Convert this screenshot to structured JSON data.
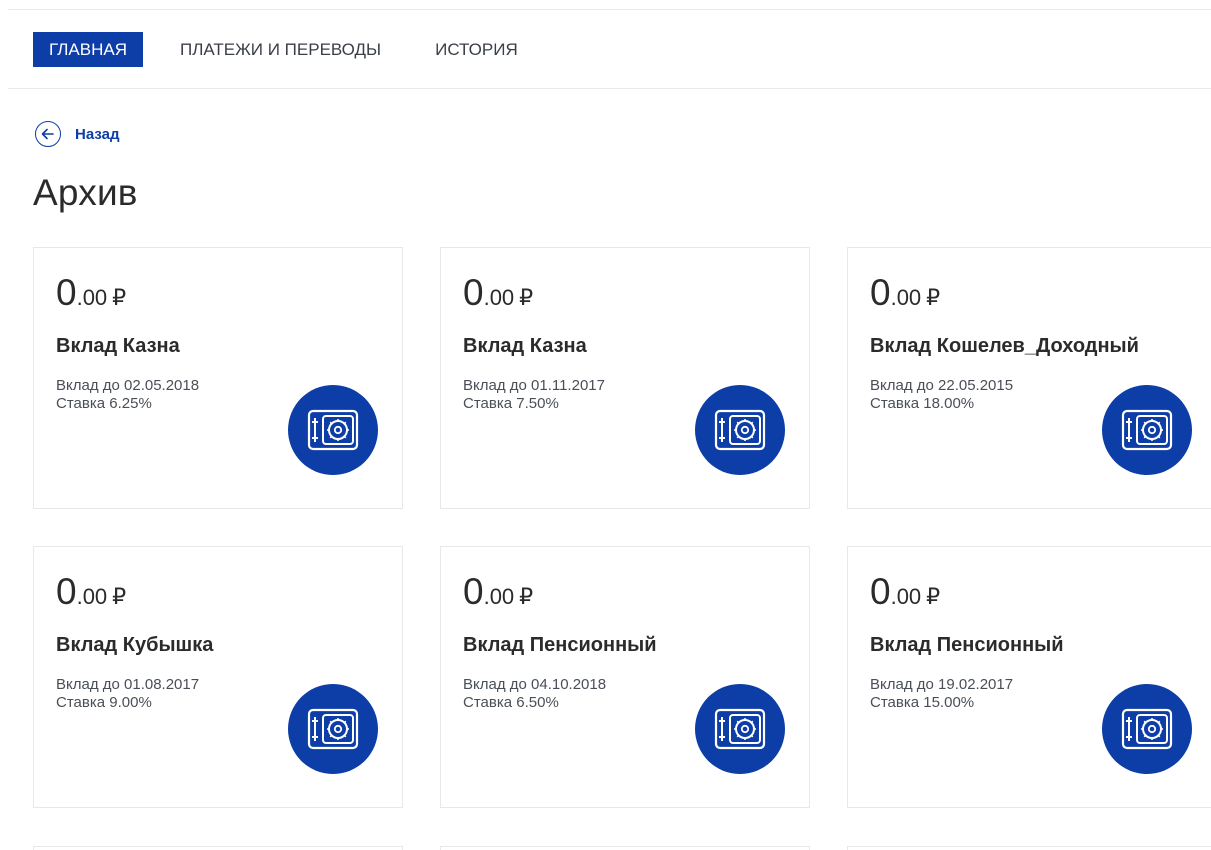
{
  "nav": {
    "tabs": [
      {
        "label": "ГЛАВНАЯ",
        "active": true
      },
      {
        "label": "ПЛАТЕЖИ И ПЕРЕВОДЫ",
        "active": false
      },
      {
        "label": "ИСТОРИЯ",
        "active": false
      }
    ]
  },
  "back": {
    "label": "Назад",
    "icon": "arrow-left-circle-icon"
  },
  "page": {
    "title": "Архив"
  },
  "colors": {
    "accent": "#0d3da6",
    "border": "#e6e8eb",
    "text": "#2b2b2b"
  },
  "deposits": [
    {
      "amount_int": "0",
      "amount_frac": ".00",
      "currency": "₽",
      "name": "Вклад Казна",
      "term": "Вклад до 02.05.2018",
      "rate": "Ставка 6.25%",
      "icon": "safe-icon"
    },
    {
      "amount_int": "0",
      "amount_frac": ".00",
      "currency": "₽",
      "name": "Вклад Казна",
      "term": "Вклад до 01.11.2017",
      "rate": "Ставка 7.50%",
      "icon": "safe-icon"
    },
    {
      "amount_int": "0",
      "amount_frac": ".00",
      "currency": "₽",
      "name": "Вклад Кошелев_Доходный",
      "term": "Вклад до 22.05.2015",
      "rate": "Ставка 18.00%",
      "icon": "safe-icon"
    },
    {
      "amount_int": "0",
      "amount_frac": ".00",
      "currency": "₽",
      "name": "Вклад Кубышка",
      "term": "Вклад до 01.08.2017",
      "rate": "Ставка 9.00%",
      "icon": "safe-icon"
    },
    {
      "amount_int": "0",
      "amount_frac": ".00",
      "currency": "₽",
      "name": "Вклад Пенсионный",
      "term": "Вклад до 04.10.2018",
      "rate": "Ставка 6.50%",
      "icon": "safe-icon"
    },
    {
      "amount_int": "0",
      "amount_frac": ".00",
      "currency": "₽",
      "name": "Вклад Пенсионный",
      "term": "Вклад до 19.02.2017",
      "rate": "Ставка 15.00%",
      "icon": "safe-icon"
    }
  ]
}
